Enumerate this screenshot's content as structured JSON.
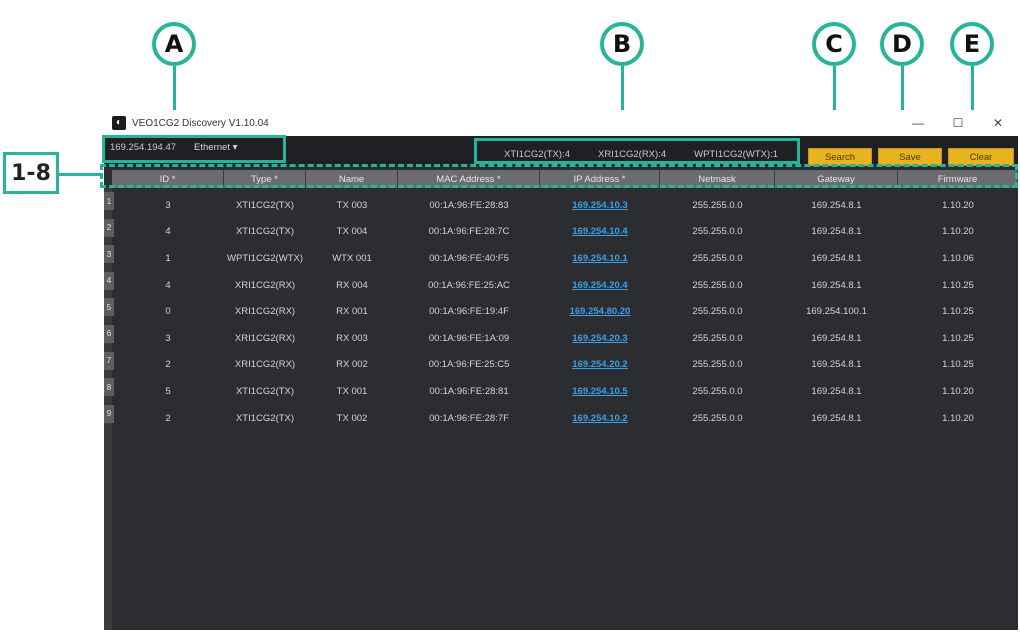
{
  "callouts": {
    "a": "A",
    "b": "B",
    "c": "C",
    "d": "D",
    "e": "E",
    "rows_label": "1-8"
  },
  "window": {
    "title": "VEO1CG2 Discovery V1.10.04",
    "minimize_glyph": "—",
    "maximize_glyph": "☐",
    "close_glyph": "✕"
  },
  "toolbar": {
    "ip": "169.254.194.47",
    "adapter": "Ethernet ▾",
    "counts": [
      "XTI1CG2(TX):4",
      "XRI1CG2(RX):4",
      "WPTI1CG2(WTX):1"
    ],
    "search_label": "Search",
    "save_label": "Save",
    "clear_label": "Clear"
  },
  "colors": {
    "accent": "#27b59a",
    "button": "#e8b320",
    "link": "#3aa0e8",
    "background": "#2c2d30"
  },
  "table": {
    "headers": [
      "ID *",
      "Type *",
      "Name",
      "MAC Address *",
      "IP Address *",
      "Netmask",
      "Gateway",
      "Firmware"
    ],
    "row_numbers": [
      "1",
      "2",
      "3",
      "4",
      "5",
      "6",
      "7",
      "8",
      "9"
    ],
    "rows": [
      [
        "3",
        "XTI1CG2(TX)",
        "TX 003",
        "00:1A:96:FE:28:83",
        "169.254.10.3",
        "255.255.0.0",
        "169.254.8.1",
        "1.10.20"
      ],
      [
        "4",
        "XTI1CG2(TX)",
        "TX 004",
        "00:1A:96:FE:28:7C",
        "169.254.10.4",
        "255.255.0.0",
        "169.254.8.1",
        "1.10.20"
      ],
      [
        "1",
        "WPTI1CG2(WTX)",
        "WTX 001",
        "00:1A:96:FE:40:F5",
        "169.254.10.1",
        "255.255.0.0",
        "169.254.8.1",
        "1.10.06"
      ],
      [
        "4",
        "XRI1CG2(RX)",
        "RX 004",
        "00:1A:96:FE:25:AC",
        "169.254.20.4",
        "255.255.0.0",
        "169.254.8.1",
        "1.10.25"
      ],
      [
        "0",
        "XRI1CG2(RX)",
        "RX 001",
        "00:1A:96:FE:19:4F",
        "169.254.80.20",
        "255.255.0.0",
        "169.254.100.1",
        "1.10.25"
      ],
      [
        "3",
        "XRI1CG2(RX)",
        "RX 003",
        "00:1A:96:FE:1A:09",
        "169.254.20.3",
        "255.255.0.0",
        "169.254.8.1",
        "1.10.25"
      ],
      [
        "2",
        "XRI1CG2(RX)",
        "RX 002",
        "00:1A:96:FE:25:C5",
        "169.254.20.2",
        "255.255.0.0",
        "169.254.8.1",
        "1.10.25"
      ],
      [
        "5",
        "XTI1CG2(TX)",
        "TX 001",
        "00:1A:96:FE:28:81",
        "169.254.10.5",
        "255.255.0.0",
        "169.254.8.1",
        "1.10.20"
      ],
      [
        "2",
        "XTI1CG2(TX)",
        "TX 002",
        "00:1A:96:FE:28:7F",
        "169.254.10.2",
        "255.255.0.0",
        "169.254.8.1",
        "1.10.20"
      ]
    ]
  }
}
